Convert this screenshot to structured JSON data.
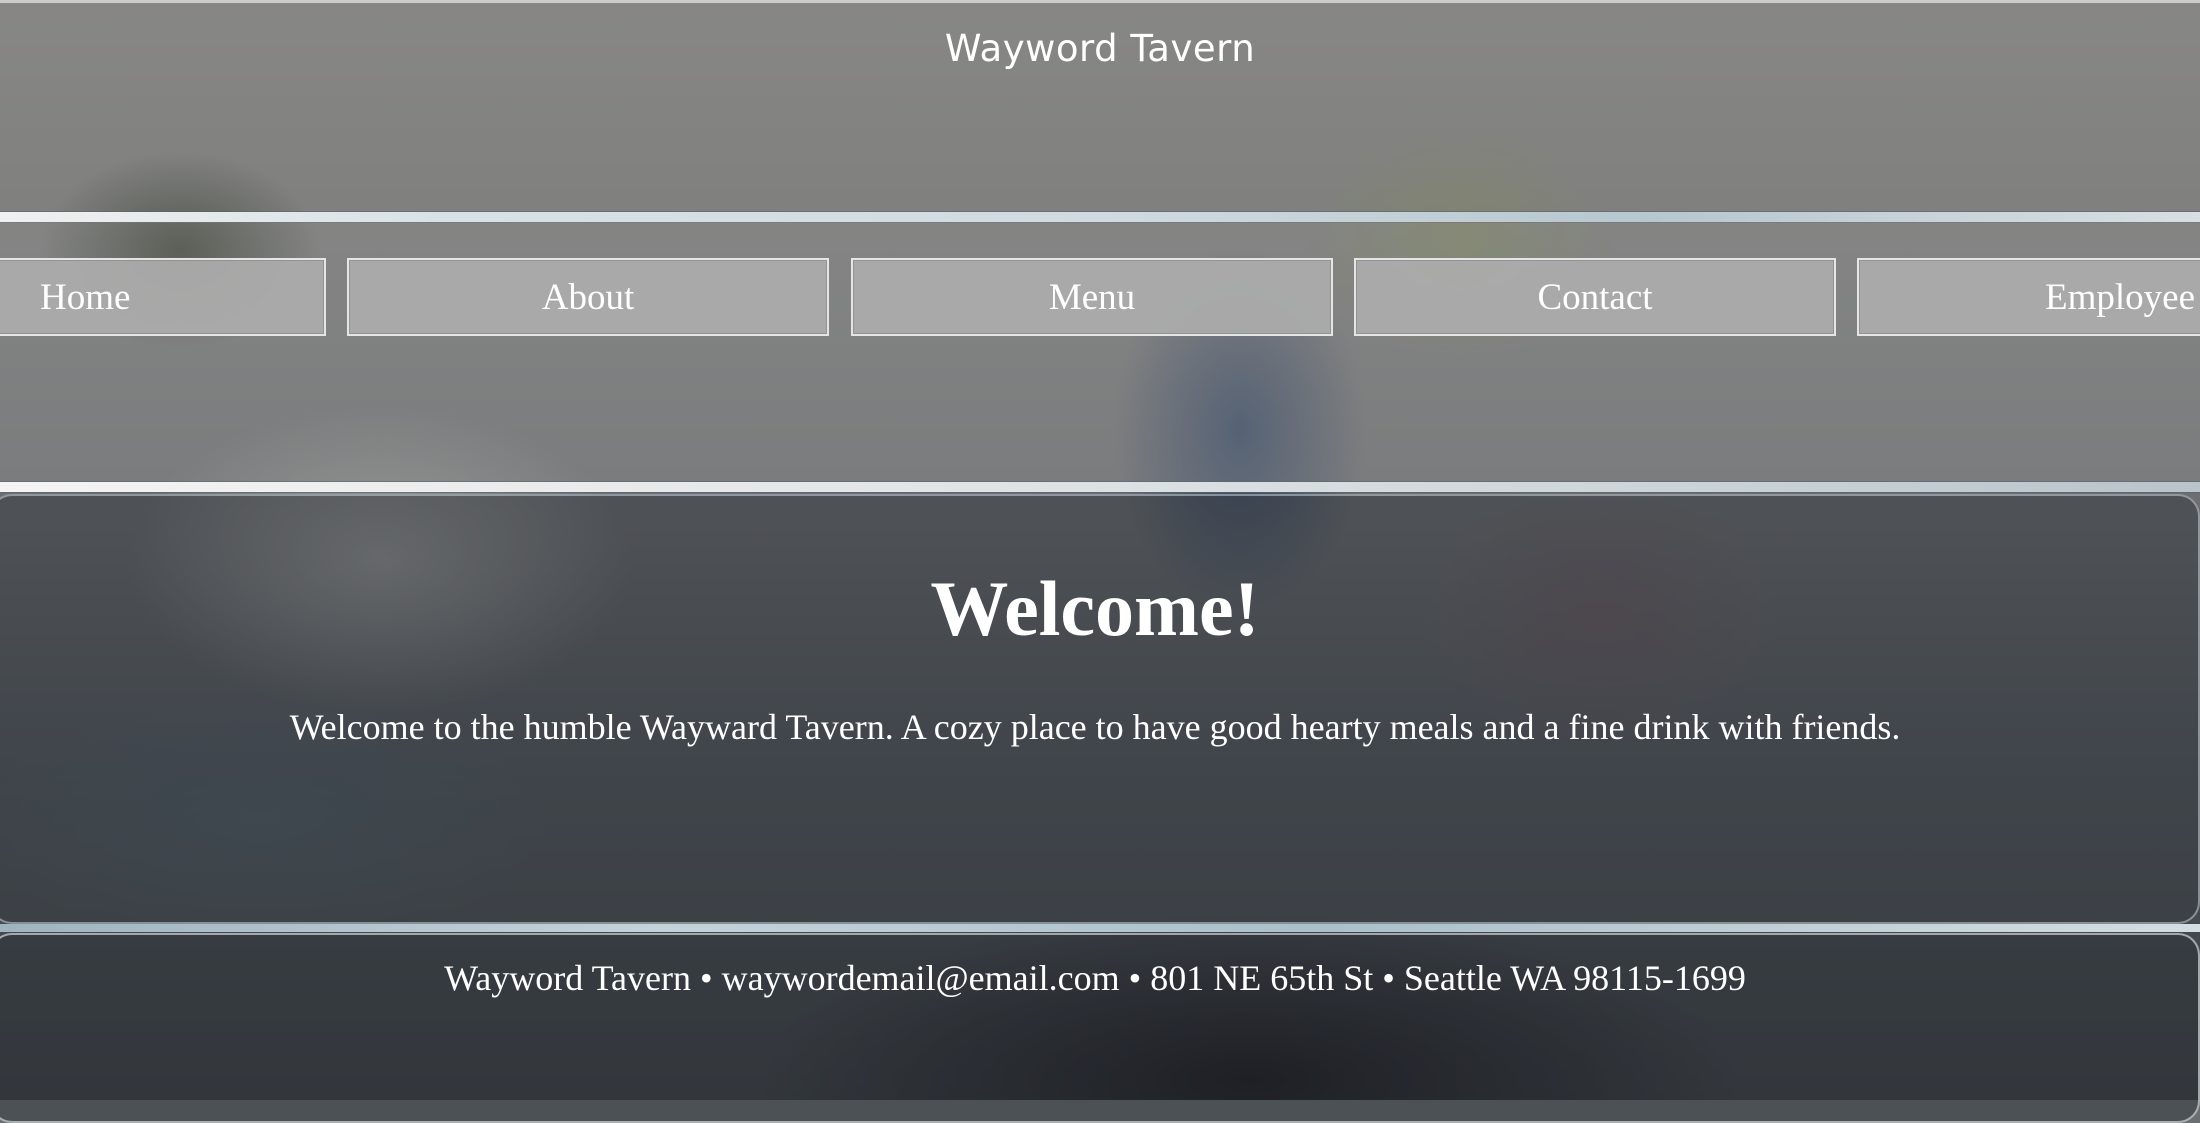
{
  "header": {
    "site_title": "Wayword Tavern"
  },
  "nav": {
    "items": [
      {
        "label": "Home"
      },
      {
        "label": "About"
      },
      {
        "label": "Menu"
      },
      {
        "label": "Contact"
      },
      {
        "label": "Employee"
      }
    ]
  },
  "main": {
    "heading": "Welcome!",
    "intro": "Welcome to the humble Wayward Tavern. A cozy place to have good hearty meals and a fine drink with friends."
  },
  "footer": {
    "text": "Wayword Tavern • waywordemail@email.com • 801 NE 65th St • Seattle WA 98115-1699"
  },
  "colors": {
    "text": "#ffffff",
    "nav_button": "#acacac",
    "rule": "#d8e2e6"
  }
}
